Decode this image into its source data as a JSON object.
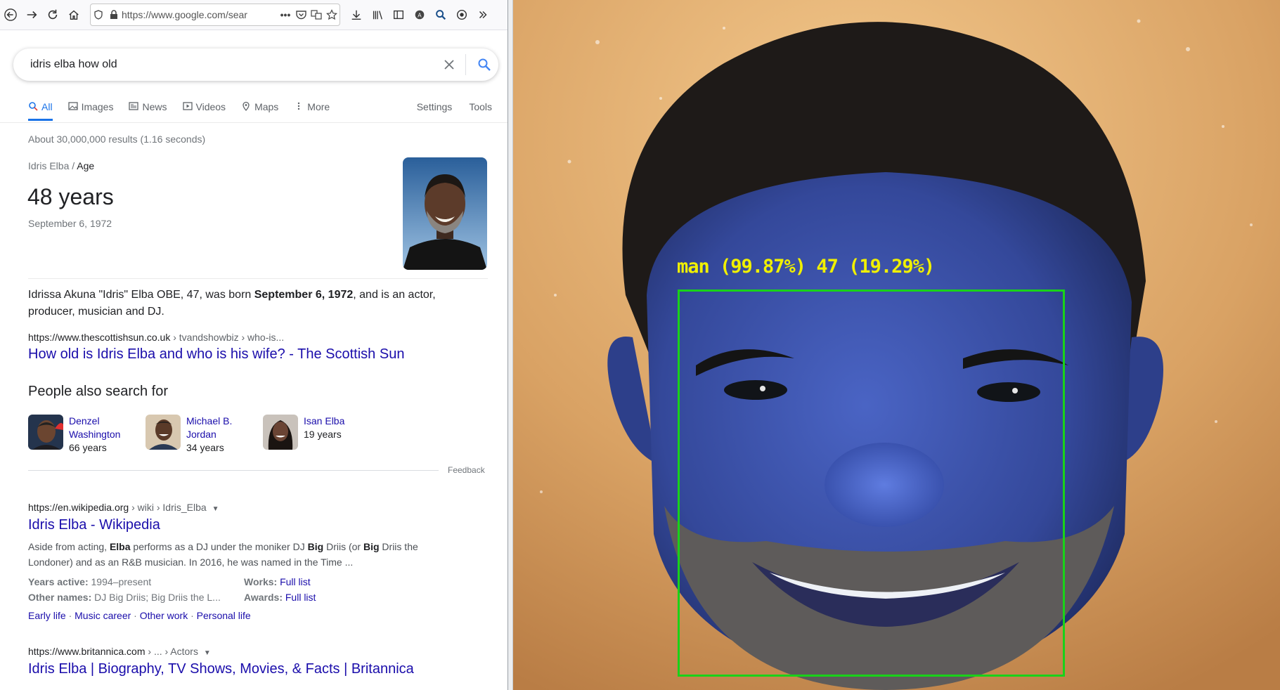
{
  "browser": {
    "url": "https://www.google.com/sear",
    "more_dots": "•••"
  },
  "search": {
    "query": "idris elba how old"
  },
  "tabs": [
    {
      "label": "All",
      "icon": "search-icon"
    },
    {
      "label": "Images",
      "icon": "image-icon"
    },
    {
      "label": "News",
      "icon": "newspaper-icon"
    },
    {
      "label": "Videos",
      "icon": "play-icon"
    },
    {
      "label": "Maps",
      "icon": "pin-icon"
    },
    {
      "label": "More",
      "icon": "more-vert-icon"
    }
  ],
  "tools": {
    "settings": "Settings",
    "tools": "Tools"
  },
  "result_stats": "About 30,000,000 results (1.16 seconds)",
  "answer": {
    "crumb_entity": "Idris Elba",
    "crumb_sep": "/",
    "crumb_attr": "Age",
    "value": "48 years",
    "date": "September 6, 1972"
  },
  "featured": {
    "snippet_pre": "Idrissa Akuna \"Idris\" Elba OBE, 47, was born ",
    "snippet_bold": "September 6, 1972",
    "snippet_post": ", and is an actor, producer, musician and DJ.",
    "cite_domain": "https://www.thescottishsun.co.uk",
    "cite_path": " › tvandshowbiz › who-is...",
    "title": "How old is Idris Elba and who is his wife? - The Scottish Sun"
  },
  "people_also_search": {
    "heading": "People also search for",
    "items": [
      {
        "name": "Denzel Washington",
        "age": "66 years"
      },
      {
        "name": "Michael B. Jordan",
        "age": "34 years"
      },
      {
        "name": "Isan Elba",
        "age": "19 years"
      }
    ],
    "feedback": "Feedback"
  },
  "wiki": {
    "cite_domain": "https://en.wikipedia.org",
    "cite_path": " › wiki › Idris_Elba",
    "title": "Idris Elba - Wikipedia",
    "desc_1": "Aside from acting, ",
    "desc_b1": "Elba",
    "desc_2": " performs as a DJ under the moniker DJ ",
    "desc_b2": "Big",
    "desc_3": " Driis (or ",
    "desc_b3": "Big",
    "desc_4": " Driis the Londoner) and as an R&B musician. In 2016, he was named in the Time ...",
    "facts": {
      "years_active_k": "Years active:",
      "years_active_v": " 1994–present",
      "other_names_k": "Other names:",
      "other_names_v": " DJ Big Driis; Big Driis the L...",
      "works_k": "Works:",
      "works_v": "Full list",
      "awards_k": "Awards:",
      "awards_v": "Full list"
    },
    "sitelinks": [
      "Early life",
      "Music career",
      "Other work",
      "Personal life"
    ],
    "sitelink_sep": " · "
  },
  "britannica": {
    "cite_domain": "https://www.britannica.com",
    "cite_path": " › ... › Actors",
    "title": "Idris Elba | Biography, TV Shows, Movies, & Facts | Britannica"
  },
  "detection": {
    "label": "man (99.87%) 47 (19.29%)",
    "label_color": "#f0f000",
    "box_color": "#19d219"
  }
}
